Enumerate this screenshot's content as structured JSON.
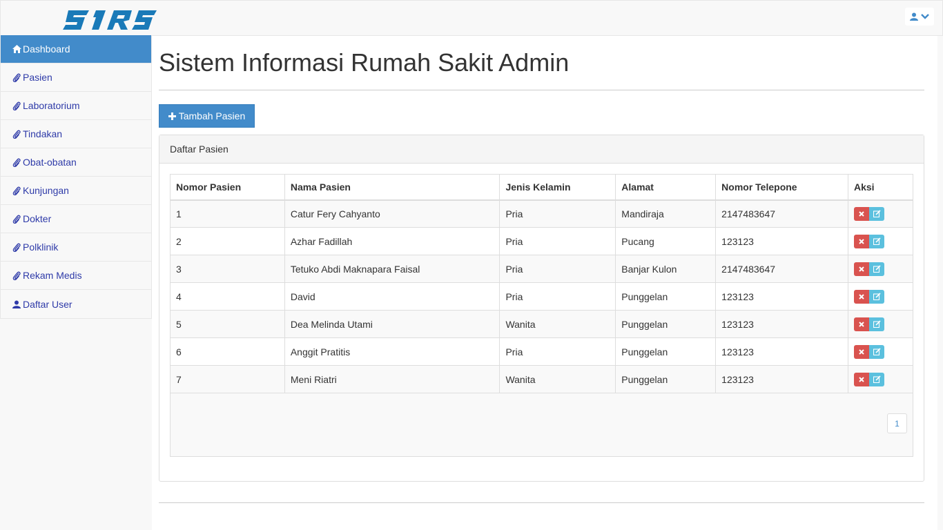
{
  "brand": {
    "logo_text": "SIRS"
  },
  "sidebar": {
    "items": [
      {
        "label": "Dashboard",
        "icon": "home-icon",
        "active": true
      },
      {
        "label": "Pasien",
        "icon": "paperclip-icon"
      },
      {
        "label": "Laboratorium",
        "icon": "paperclip-icon"
      },
      {
        "label": "Tindakan",
        "icon": "paperclip-icon"
      },
      {
        "label": "Obat-obatan",
        "icon": "paperclip-icon"
      },
      {
        "label": "Kunjungan",
        "icon": "paperclip-icon"
      },
      {
        "label": "Dokter",
        "icon": "paperclip-icon"
      },
      {
        "label": "Polklinik",
        "icon": "paperclip-icon"
      },
      {
        "label": "Rekam Medis",
        "icon": "paperclip-icon"
      },
      {
        "label": "Daftar User",
        "icon": "user-icon"
      }
    ]
  },
  "main": {
    "title": "Sistem Informasi Rumah Sakit Admin",
    "add_button": "Tambah Pasien",
    "panel_title": "Daftar Pasien",
    "columns": [
      "Nomor Pasien",
      "Nama Pasien",
      "Jenis Kelamin",
      "Alamat",
      "Nomor Telepone",
      "Aksi"
    ],
    "rows": [
      [
        "1",
        "Catur Fery Cahyanto",
        "Pria",
        "Mandiraja",
        "2147483647"
      ],
      [
        "2",
        "Azhar Fadillah",
        "Pria",
        "Pucang",
        "123123"
      ],
      [
        "3",
        "Tetuko Abdi Maknapara Faisal",
        "Pria",
        "Banjar Kulon",
        "2147483647"
      ],
      [
        "4",
        "David",
        "Pria",
        "Punggelan",
        "123123"
      ],
      [
        "5",
        "Dea Melinda Utami",
        "Wanita",
        "Punggelan",
        "123123"
      ],
      [
        "6",
        "Anggit Pratitis",
        "Pria",
        "Punggelan",
        "123123"
      ],
      [
        "7",
        "Meni Riatri",
        "Wanita",
        "Punggelan",
        "123123"
      ]
    ],
    "pagination": {
      "current_page": "1"
    }
  },
  "colors": {
    "primary": "#428bca",
    "danger": "#d9534f",
    "info": "#5bc0de",
    "link": "#2e3aa8",
    "logo": "#1a7ab8"
  }
}
